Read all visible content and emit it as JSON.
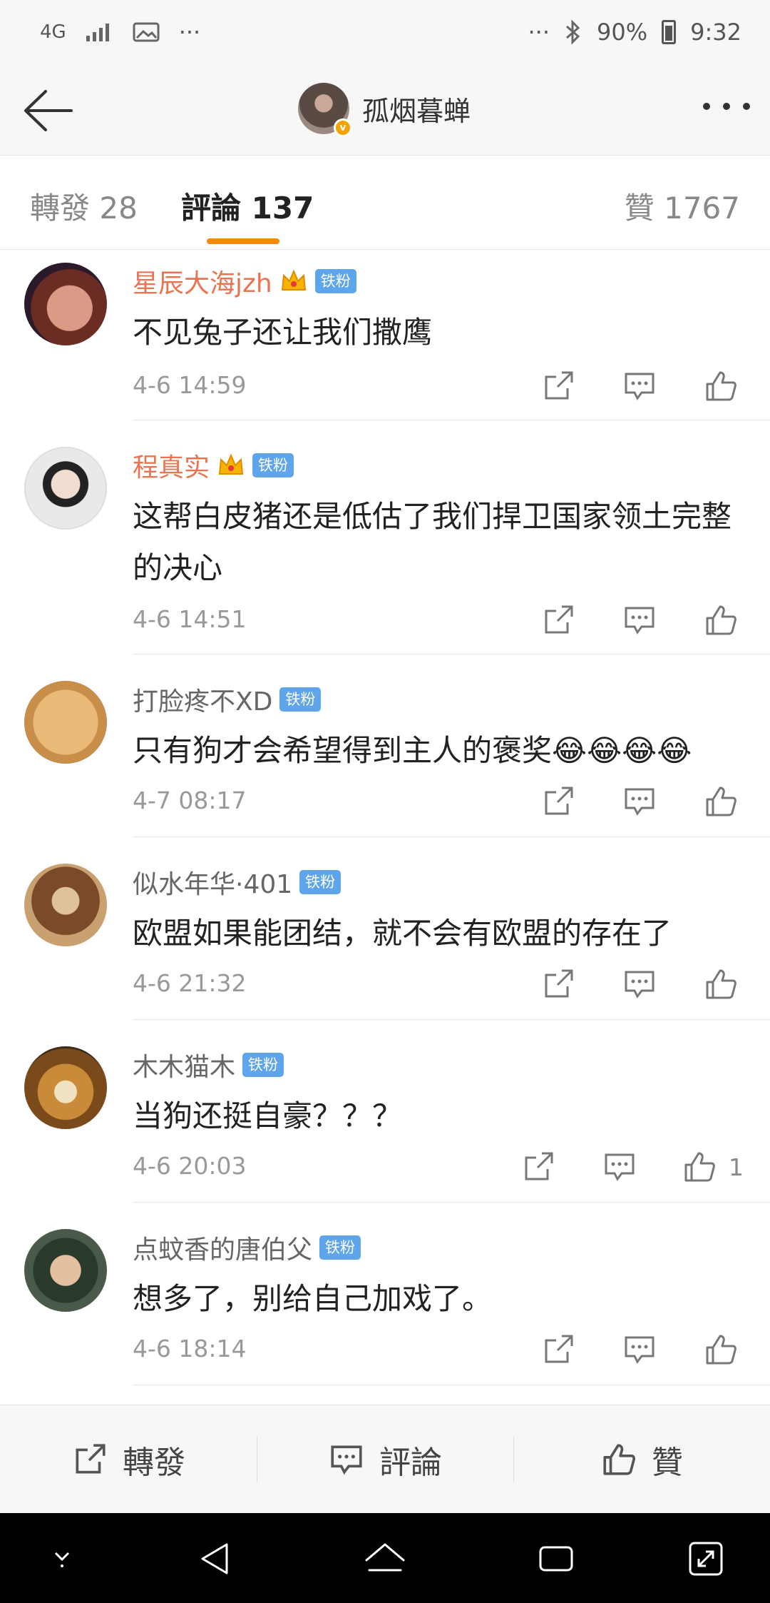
{
  "status_bar": {
    "network": "4G",
    "battery": "90%",
    "time": "9:32",
    "dots": "···"
  },
  "nav": {
    "title": "孤烟暮蝉"
  },
  "tabs": {
    "repost": "轉發 28",
    "comments": "評論 137",
    "likes": "贊 1767"
  },
  "comments": [
    {
      "user": "星辰大海jzh",
      "badge": "铁粉",
      "name_color": "orange",
      "crown": true,
      "text": "不见兔子还让我们撒鹰",
      "time": "4-6 14:59",
      "likes": ""
    },
    {
      "user": "程真实",
      "badge": "铁粉",
      "name_color": "orange",
      "crown": true,
      "text": "这帮白皮猪还是低估了我们捍卫国家领土完整的决心",
      "time": "4-6 14:51",
      "likes": ""
    },
    {
      "user": "打脸疼不XD",
      "badge": "铁粉",
      "name_color": "gray",
      "crown": false,
      "text": "只有狗才会希望得到主人的褒奖😂😂😂😂",
      "time": "4-7 08:17",
      "likes": ""
    },
    {
      "user": "似水年华·401",
      "badge": "铁粉",
      "name_color": "gray",
      "crown": false,
      "text": "欧盟如果能团结，就不会有欧盟的存在了",
      "time": "4-6 21:32",
      "likes": ""
    },
    {
      "user": "木木猫木",
      "badge": "铁粉",
      "name_color": "gray",
      "crown": false,
      "text": "当狗还挺自豪？？？",
      "time": "4-6 20:03",
      "likes": "1"
    },
    {
      "user": "点蚊香的唐伯父",
      "badge": "铁粉",
      "name_color": "gray",
      "crown": false,
      "text": "想多了，别给自己加戏了。",
      "time": "4-6 18:14",
      "likes": ""
    }
  ],
  "toolbar": {
    "repost": "轉發",
    "comment": "評論",
    "like": "贊"
  },
  "colors": {
    "accent": "#f28b00",
    "name_orange": "#eb7350",
    "badge_blue": "#5ea5ec"
  }
}
